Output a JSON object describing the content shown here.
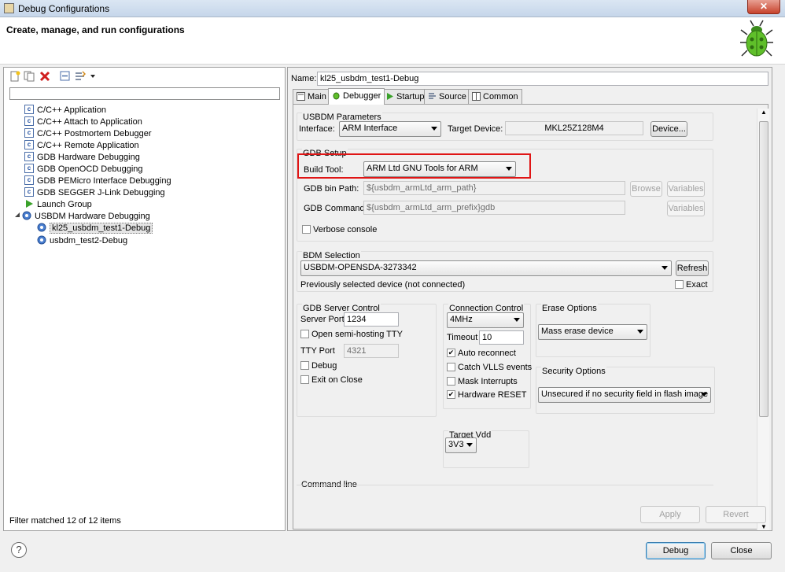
{
  "window": {
    "title": "Debug Configurations",
    "close_label": "✕"
  },
  "header": {
    "title": "Create, manage, and run configurations"
  },
  "left": {
    "tree": [
      {
        "label": "C/C++ Application",
        "icon": "c-config-icon"
      },
      {
        "label": "C/C++ Attach to Application",
        "icon": "c-config-icon"
      },
      {
        "label": "C/C++ Postmortem Debugger",
        "icon": "c-config-icon"
      },
      {
        "label": "C/C++ Remote Application",
        "icon": "c-config-icon"
      },
      {
        "label": "GDB Hardware Debugging",
        "icon": "c-config-icon"
      },
      {
        "label": "GDB OpenOCD Debugging",
        "icon": "c-config-icon"
      },
      {
        "label": "GDB PEMicro Interface Debugging",
        "icon": "c-config-icon"
      },
      {
        "label": "GDB SEGGER J-Link Debugging",
        "icon": "c-config-icon"
      },
      {
        "label": "Launch Group",
        "icon": "launch-arrow-icon"
      },
      {
        "label": "USBDM Hardware Debugging",
        "icon": "gear-icon"
      },
      {
        "label": "kl25_usbdm_test1-Debug",
        "icon": "gear-icon"
      },
      {
        "label": "usbdm_test2-Debug",
        "icon": "gear-icon"
      }
    ],
    "filter_status": "Filter matched 12 of 12 items"
  },
  "right": {
    "name_label": "Name:",
    "name_value": "kl25_usbdm_test1-Debug",
    "tabs": [
      "Main",
      "Debugger",
      "Startup",
      "Source",
      "Common"
    ],
    "usbdm_params": {
      "title": "USBDM Parameters",
      "interface_label": "Interface:",
      "interface_value": "ARM Interface",
      "target_label": "Target Device:",
      "target_value": "MKL25Z128M4",
      "device_button": "Device..."
    },
    "gdb_setup": {
      "title": "GDB Setup",
      "build_tool_label": "Build Tool:",
      "build_tool_value": "ARM Ltd GNU Tools for ARM",
      "bin_path_label": "GDB bin Path:",
      "bin_path_value": "${usbdm_armLtd_arm_path}",
      "browse": "Browse",
      "variables": "Variables",
      "command_label": "GDB Command:",
      "command_value": "${usbdm_armLtd_arm_prefix}gdb",
      "verbose": "Verbose console"
    },
    "bdm": {
      "title": "BDM Selection",
      "device": "USBDM-OPENSDA-3273342",
      "refresh": "Refresh",
      "status": "Previously selected device (not connected)",
      "exact": "Exact"
    },
    "server": {
      "title": "GDB Server Control",
      "port_label": "Server Port",
      "port_value": "1234",
      "semihost": "Open semi-hosting TTY",
      "tty_label": "TTY Port",
      "tty_value": "4321",
      "debug": "Debug",
      "exit": "Exit on Close"
    },
    "connection": {
      "title": "Connection Control",
      "speed": "4MHz",
      "timeout_label": "Timeout",
      "timeout_value": "10",
      "auto_reconnect": "Auto reconnect",
      "catch_vlls": "Catch VLLS events",
      "mask_interrupts": "Mask Interrupts",
      "hardware_reset": "Hardware RESET"
    },
    "erase": {
      "title": "Erase Options",
      "value": "Mass erase device"
    },
    "security": {
      "title": "Security Options",
      "value": "Unsecured if no security field in flash image"
    },
    "vdd": {
      "title": "Target Vdd",
      "value": "3V3"
    },
    "command_line": "Command line",
    "apply": "Apply",
    "revert": "Revert"
  },
  "footer": {
    "help": "?",
    "debug": "Debug",
    "close": "Close"
  }
}
